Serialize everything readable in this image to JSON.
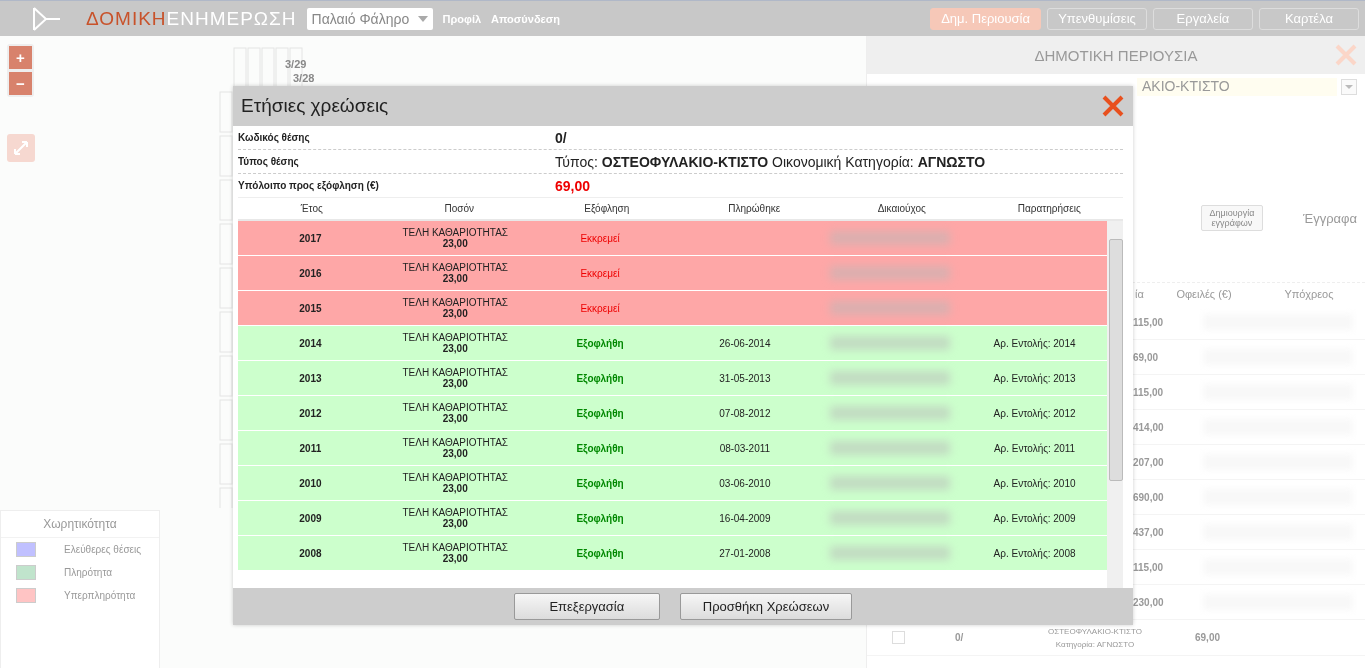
{
  "header": {
    "logo": {
      "part_1": "ΔΟΜΙΚΗ",
      "part_2": "ΕΝΗΜΕΡΩΣΗ"
    },
    "area_select": {
      "value": "Παλαιό Φάληρο"
    },
    "links": [
      "Προφίλ",
      "Αποσύνδεση"
    ],
    "nav": [
      {
        "label": "Δημ. Περιουσία",
        "selected": true
      },
      {
        "label": "Υπενθυμίσεις",
        "selected": false
      },
      {
        "label": "Εργαλεία",
        "selected": false
      },
      {
        "label": "Καρτέλα",
        "selected": false
      }
    ]
  },
  "map": {
    "zoom_buttons": [
      "+",
      "−"
    ],
    "plot_labels": [
      "3/29",
      "3/28"
    ],
    "legend": {
      "title": "Χωρητικότητα",
      "items": [
        {
          "label": "Ελεύθερες θέσεις",
          "color": "#c0c0ff"
        },
        {
          "label": "Πληρότητα",
          "color": "#c0e4cc"
        },
        {
          "label": "Υπερπληρότητα",
          "color": "#ffc4c4"
        }
      ]
    }
  },
  "right_panel": {
    "title": "ΔΗΜΟΤΙΚΗ ΠΕΡΙΟΥΣΙΑ",
    "type_select": {
      "value": "ΑΚΙΟ-ΚΤΙΣΤΟ"
    },
    "documents_button": "Δημιουργία εγγράφων",
    "documents_label": "Έγγραφα",
    "columns": [
      "ία",
      "Οφειλές (€)",
      "Υπόχρεος"
    ],
    "amounts": [
      "115,00",
      "69,00",
      "115,00",
      "414,00",
      "207,00",
      "690,00",
      "437,00",
      "115,00",
      "230,00"
    ],
    "last_row": {
      "code": "0/",
      "type": "ΟΣΤΕΟΦΥΛΑΚΙΟ-ΚΤΙΣΤΟ",
      "category": "Κατηγορία: ΑΓΝΩΣΤΟ",
      "amount": "69,00",
      "checked": false
    }
  },
  "modal": {
    "title": "Ετήσιες χρεώσεις",
    "fields": [
      {
        "label": "Κωδικός θέσης",
        "value": "0/",
        "kind": "code"
      },
      {
        "label": "Τύπος θέσης",
        "value": "Τύπος: **ΟΣΤΕΟΦΥΛΑΚΙΟ-ΚΤΙΣΤΟ** Οικονομική Κατηγορία: **ΑΓΝΩΣΤΟ**",
        "kind": "text"
      },
      {
        "label": "Υπόλοιπο προς εξόφληση (€)",
        "value": "69,00",
        "kind": "amount"
      }
    ],
    "columns": [
      "Έτος",
      "Ποσόν",
      "Εξόφληση",
      "Πληρώθηκε",
      "Δικαιούχος",
      "Παρατηρήσεις"
    ],
    "rows": [
      {
        "year": "2017",
        "fee": "ΤΕΛΗ ΚΑΘΑΡΙΟΤΗΤΑΣ",
        "amount": "23,00",
        "status": "Εκκρεμεί",
        "paid": false
      },
      {
        "year": "2016",
        "fee": "ΤΕΛΗ ΚΑΘΑΡΙΟΤΗΤΑΣ",
        "amount": "23,00",
        "status": "Εκκρεμεί",
        "paid": false
      },
      {
        "year": "2015",
        "fee": "ΤΕΛΗ ΚΑΘΑΡΙΟΤΗΤΑΣ",
        "amount": "23,00",
        "status": "Εκκρεμεί",
        "paid": false
      },
      {
        "year": "2014",
        "fee": "ΤΕΛΗ ΚΑΘΑΡΙΟΤΗΤΑΣ",
        "amount": "23,00",
        "status": "Εξοφλήθη",
        "paid": true,
        "paid_on": "26-06-2014",
        "notes": "Αρ. Εντολής: 2014"
      },
      {
        "year": "2013",
        "fee": "ΤΕΛΗ ΚΑΘΑΡΙΟΤΗΤΑΣ",
        "amount": "23,00",
        "status": "Εξοφλήθη",
        "paid": true,
        "paid_on": "31-05-2013",
        "notes": "Αρ. Εντολής: 2013"
      },
      {
        "year": "2012",
        "fee": "ΤΕΛΗ ΚΑΘΑΡΙΟΤΗΤΑΣ",
        "amount": "23,00",
        "status": "Εξοφλήθη",
        "paid": true,
        "paid_on": "07-08-2012",
        "notes": "Αρ. Εντολής: 2012"
      },
      {
        "year": "2011",
        "fee": "ΤΕΛΗ ΚΑΘΑΡΙΟΤΗΤΑΣ",
        "amount": "23,00",
        "status": "Εξοφλήθη",
        "paid": true,
        "paid_on": "08-03-2011",
        "notes": "Αρ. Εντολής: 2011"
      },
      {
        "year": "2010",
        "fee": "ΤΕΛΗ ΚΑΘΑΡΙΟΤΗΤΑΣ",
        "amount": "23,00",
        "status": "Εξοφλήθη",
        "paid": true,
        "paid_on": "03-06-2010",
        "notes": "Αρ. Εντολής: 2010"
      },
      {
        "year": "2009",
        "fee": "ΤΕΛΗ ΚΑΘΑΡΙΟΤΗΤΑΣ",
        "amount": "23,00",
        "status": "Εξοφλήθη",
        "paid": true,
        "paid_on": "16-04-2009",
        "notes": "Αρ. Εντολής: 2009"
      },
      {
        "year": "2008",
        "fee": "ΤΕΛΗ ΚΑΘΑΡΙΟΤΗΤΑΣ",
        "amount": "23,00",
        "status": "Εξοφλήθη",
        "paid": true,
        "paid_on": "27-01-2008",
        "notes": "Αρ. Εντολής: 2008"
      }
    ],
    "buttons": [
      "Επεξεργασία",
      "Προσθήκη Χρεώσεων"
    ]
  }
}
